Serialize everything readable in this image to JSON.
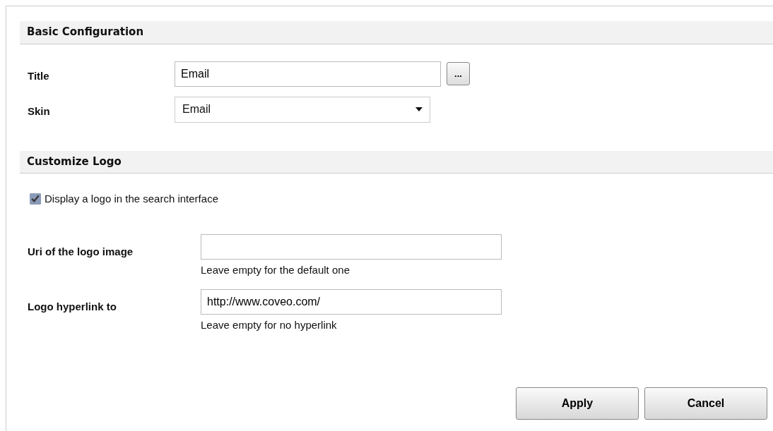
{
  "sections": [
    {
      "title": "Basic Configuration",
      "fields": [
        {
          "kind": "text",
          "label": "Title",
          "value": "Email",
          "picker": "..."
        },
        {
          "kind": "select",
          "label": "Skin",
          "value": "Email"
        }
      ]
    },
    {
      "title": "Customize Logo",
      "checkbox": {
        "label": "Display a logo in the search interface",
        "checked": true
      },
      "fields": [
        {
          "kind": "text",
          "label": "Uri of the logo image",
          "help": "Leave empty for the default one"
        },
        {
          "kind": "text",
          "label": "Logo hyperlink to",
          "value": "http://www.coveo.com/",
          "help": "Leave empty for no hyperlink"
        }
      ]
    }
  ],
  "buttons": [
    "Apply",
    "Cancel"
  ]
}
